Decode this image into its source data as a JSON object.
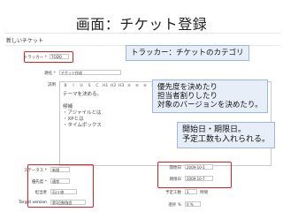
{
  "slide": {
    "title": "画面：チケット登録"
  },
  "form": {
    "page_title": "新しいチケット",
    "tracker": {
      "label": "トラッカー *",
      "value": "TODO"
    },
    "subject": {
      "label": "題名 *",
      "value": "チケット作成"
    },
    "description": {
      "label": "説明",
      "toolbar": [
        "B",
        "I",
        "U",
        "S",
        "C",
        "H1",
        "H2",
        "H3",
        "≡",
        "≡",
        "≡",
        "≡"
      ],
      "text": "テーマを決める。\n\n候補\n・アジャイルとは\n・XPとは\n・タイムボックス"
    },
    "status": {
      "label": "ステータス *",
      "value": "新規"
    },
    "priority": {
      "label": "優先度 *",
      "value": "通常"
    },
    "assignee": {
      "label": "担当者",
      "value": "石川 修"
    },
    "target_version": {
      "label": "Target version",
      "value": "第1回勉強会"
    },
    "start_date": {
      "label": "開始日",
      "value": "2009-10-1"
    },
    "due_date": {
      "label": "期限日",
      "value": "2009-10-7"
    },
    "estimated_hours": {
      "label": "予定工数",
      "value": "1",
      "unit": "時間"
    },
    "done_ratio": {
      "label": "進捗 %",
      "value": "0 %",
      "fraction": 0
    }
  },
  "callouts": {
    "tracker": "トラッカー：チケットのカテゴリ",
    "attrs": "優先度を決めたり\n担当者割りしたり\n対象のバージョンを決めたり。",
    "dates": "開始日・期限日。\n予定工数も入れられる。"
  },
  "colors": {
    "highlight": "#e02020",
    "callout_bg": "#e7eef8",
    "progress": "#2f9e3a"
  }
}
